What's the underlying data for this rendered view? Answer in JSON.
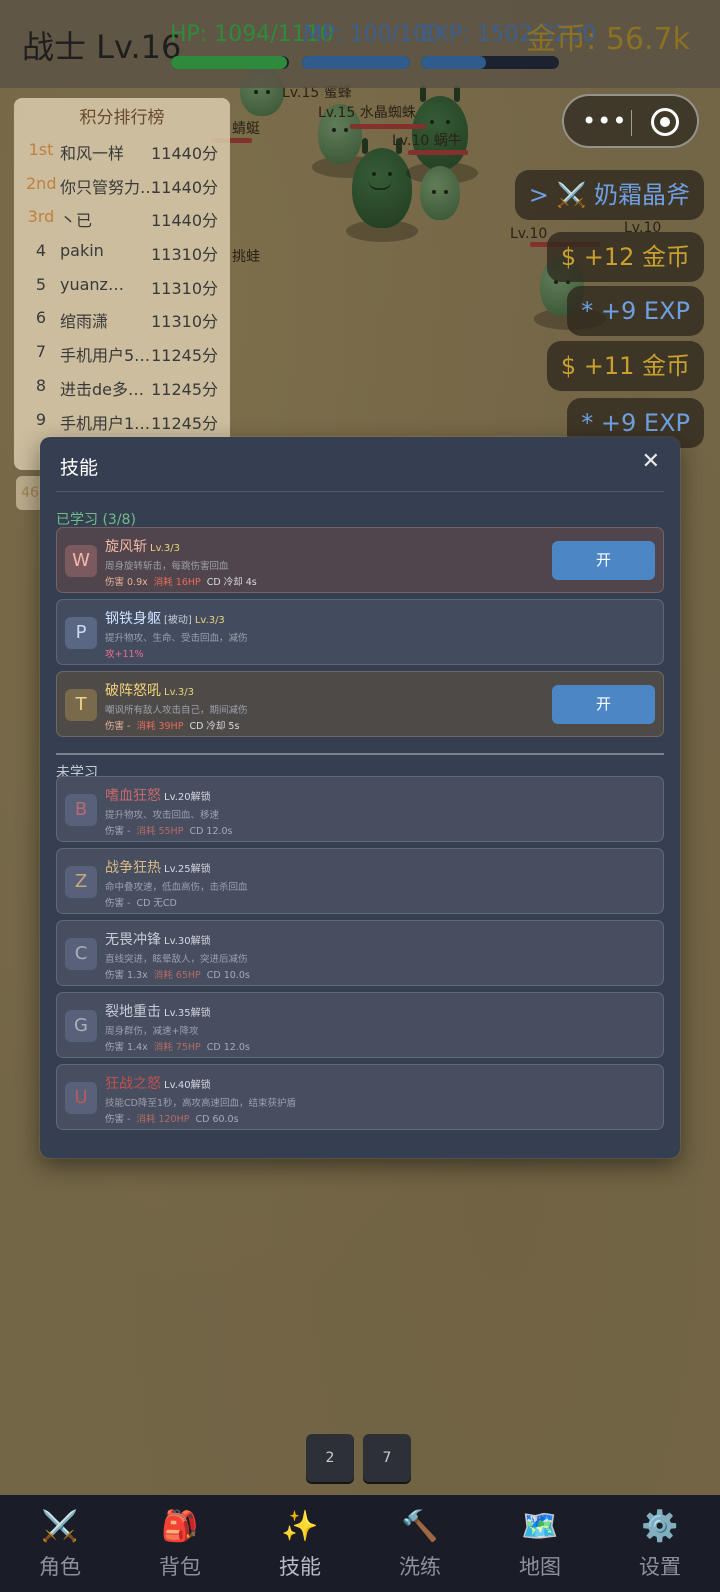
{
  "hud": {
    "title": "战士 Lv.16",
    "hp_text": "HP: 1094/1110",
    "mp_text": "MP: 100/100",
    "exp_text": "EXP: 1502/3200",
    "hp_fraction": 0.986,
    "mp_fraction": 1.0,
    "exp_fraction": 0.469,
    "gold_text": "金币: 56.7k"
  },
  "world_labels": {
    "mob1": "Lv.15 蜜蜂",
    "mob2": "Lv.15 水晶蜘蛛",
    "mob3": "Lv.10 蜗牛",
    "mob4": "蜻蜓",
    "mob5": "Lv.10",
    "mob6": "Lv.10",
    "mob7": "挑蛙"
  },
  "toasts": [
    {
      "text": "> ⚔️ 奶霜晶斧",
      "tone": "blue"
    },
    {
      "text": "$ +12 金币",
      "tone": "gold"
    },
    {
      "text": "* +9 EXP",
      "tone": "blue"
    },
    {
      "text": "$ +11 金币",
      "tone": "gold"
    },
    {
      "text": "* +9 EXP",
      "tone": "blue"
    }
  ],
  "leaderboard": {
    "title": "积分排行榜",
    "rows": [
      {
        "rank": "1st",
        "name": "和风一样",
        "score": "11440分"
      },
      {
        "rank": "2nd",
        "name": "你只管努力…",
        "score": "11440分"
      },
      {
        "rank": "3rd",
        "name": "丶已",
        "score": "11440分"
      },
      {
        "rank": "4",
        "name": "pakin",
        "score": "11310分"
      },
      {
        "rank": "5",
        "name": "yuanz…",
        "score": "11310分"
      },
      {
        "rank": "6",
        "name": "绾雨潇",
        "score": "11310分"
      },
      {
        "rank": "7",
        "name": "手机用户5…",
        "score": "11245分"
      },
      {
        "rank": "8",
        "name": "进击de多…",
        "score": "11245分"
      },
      {
        "rank": "9",
        "name": "手机用户1…",
        "score": "11245分"
      }
    ],
    "extra_badge": "46"
  },
  "modal": {
    "title": "技能",
    "close_glyph": "✕",
    "learned_title": "已学习 (3/8)",
    "locked_title": "未学习",
    "learned": [
      {
        "key": "W",
        "name": "旋风斩",
        "level": "Lv.3/3",
        "tag": "",
        "desc": "周身旋转斩击，每跳伤害回血",
        "info": [
          "伤害 0.9x",
          "消耗 16HP",
          "CD 冷却 4s"
        ],
        "toggle": "开",
        "name_color": "#f2b8a6",
        "badge_bg": "#7a5a5e",
        "badge_fg": "#f0b8a8"
      },
      {
        "key": "P",
        "name": "钢铁身躯",
        "level": "Lv.3/3",
        "tag": "[被动]",
        "desc": "提升物攻、生命、受击回血，减伤",
        "info": [
          "攻+11%"
        ],
        "toggle": "",
        "name_color": "#cfe0ff",
        "badge_bg": "#5a6784",
        "badge_fg": "#cfd8ee"
      },
      {
        "key": "T",
        "name": "破阵怒吼",
        "level": "Lv.3/3",
        "tag": "",
        "desc": "嘲讽所有敌人攻击自己，期间减伤",
        "info": [
          "伤害 -",
          "消耗 39HP",
          "CD 冷却 5s"
        ],
        "toggle": "开",
        "name_color": "#f3d37a",
        "badge_bg": "#7a6a4c",
        "badge_fg": "#f2d48a"
      }
    ],
    "locked": [
      {
        "key": "B",
        "name": "嗜血狂怒",
        "unlock": "Lv.20解锁",
        "desc": "提升物攻、攻击回血、移速",
        "info": [
          "伤害 -",
          "消耗 55HP",
          "CD 12.0s"
        ],
        "name_color": "#c8676a",
        "badge_fg": "#b86a70"
      },
      {
        "key": "Z",
        "name": "战争狂热",
        "unlock": "Lv.25解锁",
        "desc": "命中叠攻速，低血高伤，击杀回血",
        "info": [
          "伤害 -",
          "CD 无CD"
        ],
        "name_color": "#d8b886",
        "badge_fg": "#c8a880"
      },
      {
        "key": "C",
        "name": "无畏冲锋",
        "unlock": "Lv.30解锁",
        "desc": "直线突进，眩晕敌人，突进后减伤",
        "info": [
          "伤害 1.3x",
          "消耗 65HP",
          "CD 10.0s"
        ],
        "name_color": "#c8ccd6",
        "badge_fg": "#aab0bc"
      },
      {
        "key": "G",
        "name": "裂地重击",
        "unlock": "Lv.35解锁",
        "desc": "周身群伤，减速+降攻",
        "info": [
          "伤害 1.4x",
          "消耗 75HP",
          "CD 12.0s"
        ],
        "name_color": "#c8ccd6",
        "badge_fg": "#aab0bc"
      },
      {
        "key": "U",
        "name": "狂战之怒",
        "unlock": "Lv.40解锁",
        "desc": "技能CD降至1秒，高攻高速回血，结束获护盾",
        "info": [
          "伤害 -",
          "消耗 120HP",
          "CD 60.0s"
        ],
        "name_color": "#c0504f",
        "badge_fg": "#b85a5e"
      }
    ]
  },
  "pager": [
    "2",
    "7"
  ],
  "nav": [
    {
      "icon": "⚔️",
      "label": "角色"
    },
    {
      "icon": "🎒",
      "label": "背包"
    },
    {
      "icon": "✨",
      "label": "技能"
    },
    {
      "icon": "🔨",
      "label": "洗练"
    },
    {
      "icon": "🗺️",
      "label": "地图"
    },
    {
      "icon": "⚙️",
      "label": "设置"
    }
  ]
}
